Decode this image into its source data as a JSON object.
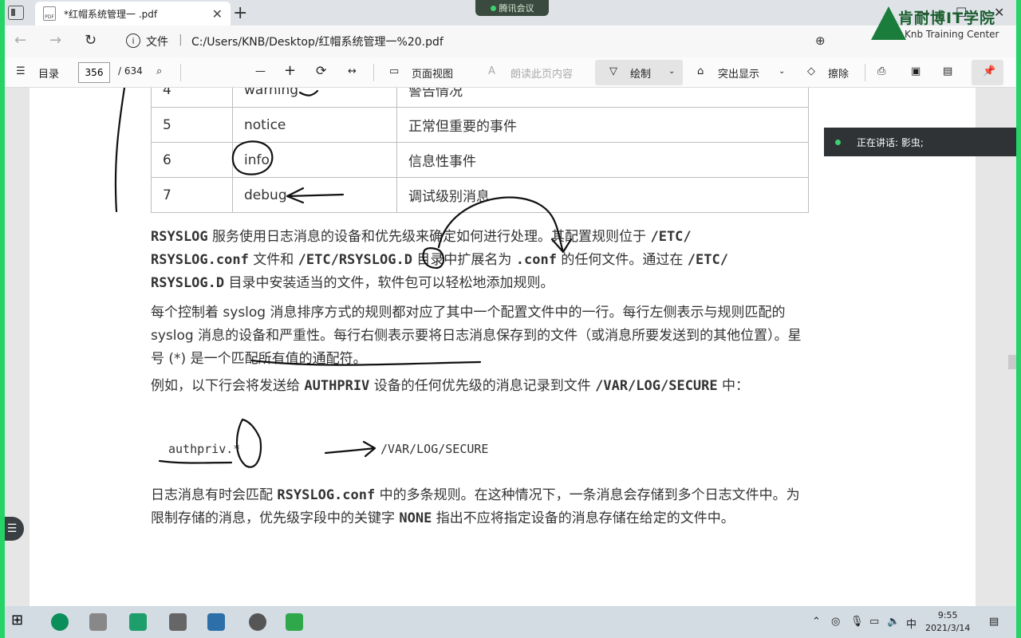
{
  "window": {
    "tab_title": "*红帽系统管理一 .pdf",
    "tab_close": "✕",
    "new_tab": "+",
    "meeting_label": "腾讯会议",
    "minimize": "—",
    "maximize": "☐",
    "close": "✕"
  },
  "address": {
    "label": "文件",
    "separator": "|",
    "url": "C:/Users/KNB/Desktop/红帽系统管理一%20.pdf"
  },
  "logo": {
    "cn": "肯耐博IT学院",
    "en": "Knb Training Center"
  },
  "toolbar": {
    "toc_label": "目录",
    "current_page": "356",
    "total_pages": "/ 634",
    "zoom_out": "—",
    "zoom_in": "+",
    "page_view": "页面视图",
    "read_aloud": "朗读此页内容",
    "draw": "绘制",
    "highlight": "突出显示",
    "erase": "擦除"
  },
  "meeting_status": {
    "speaking": "正在讲话: 影虫;"
  },
  "levels_table": {
    "rows": [
      {
        "num": "4",
        "name": "warning",
        "desc": "警告情况"
      },
      {
        "num": "5",
        "name": "notice",
        "desc": "正常但重要的事件"
      },
      {
        "num": "6",
        "name": "info",
        "desc": "信息性事件"
      },
      {
        "num": "7",
        "name": "debug",
        "desc": "调试级别消息"
      }
    ]
  },
  "paragraphs": {
    "p1": {
      "a": "RSYSLOG",
      "b": " 服务使用日志消息的设备和优先级来确定如何进行处理。其配置规则位于 ",
      "c": "/ETC/",
      "d": "RSYSLOG.conf",
      "e": " 文件和 ",
      "f": "/ETC/RSYSLOG.D",
      "g": " 目录中扩展名为 ",
      "h": ".conf",
      "i": " 的任何文件。通过在 ",
      "j": "/ETC/",
      "k": "RSYSLOG.D",
      "l": " 目录中安装适当的文件，软件包可以轻松地添加规则。"
    },
    "p2": "每个控制着 syslog 消息排序方式的规则都对应了其中一个配置文件中的一行。每行左侧表示与规则匹配的 syslog 消息的设备和严重性。每行右侧表示要将日志消息保存到的文件（或消息所要发送到的其他位置）。星号 (*) 是一个匹配所有值的通配符。",
    "p3": {
      "a": "例如，以下行会将发送给 ",
      "b": "AUTHPRIV",
      "c": " 设备的任何优先级的消息记录到文件 ",
      "d": "/VAR/LOG/SECURE",
      "e": " 中："
    },
    "code_left": "authpriv.*",
    "code_right": "/VAR/LOG/SECURE",
    "p4": {
      "a": "日志消息有时会匹配 ",
      "b": "RSYSLOG.conf",
      "c": " 中的多条规则。在这种情况下，一条消息会存储到多个日志文件中。为限制存储的消息，优先级字段中的关键字 ",
      "d": "NONE",
      "e": " 指出不应将指定设备的消息存储在给定的文件中。"
    }
  },
  "taskbar": {
    "ime": "中",
    "time": "9:55",
    "date": "2021/3/14"
  }
}
